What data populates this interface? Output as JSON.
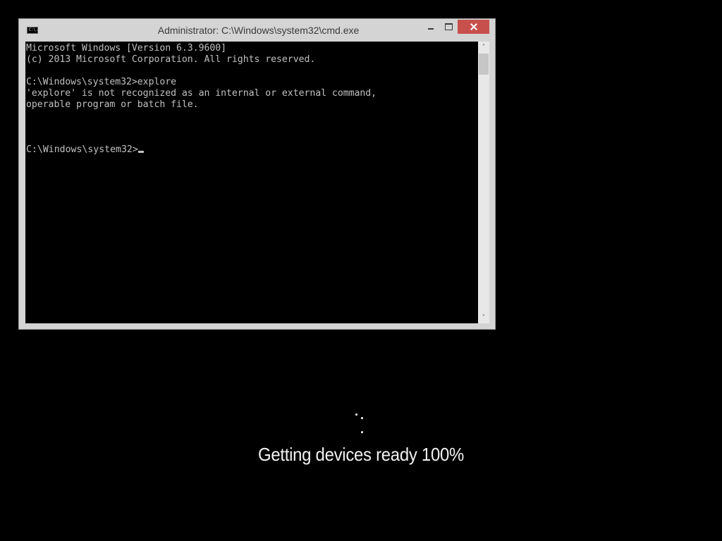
{
  "window": {
    "title": "Administrator: C:\\Windows\\system32\\cmd.exe",
    "icon_label": "C:\\.",
    "close_color": "#c7504c"
  },
  "console": {
    "lines": [
      "Microsoft Windows [Version 6.3.9600]",
      "(c) 2013 Microsoft Corporation. All rights reserved.",
      "",
      "C:\\Windows\\system32>explore",
      "'explore' is not recognized as an internal or external command,",
      "operable program or batch file.",
      ""
    ],
    "prompt": "C:\\Windows\\system32>"
  },
  "scrollbar": {
    "up_icon": "chevron-up-icon",
    "down_icon": "chevron-down-icon",
    "up_glyph": "˄",
    "down_glyph": "˅"
  },
  "status": {
    "message": "Getting devices ready 100%"
  }
}
